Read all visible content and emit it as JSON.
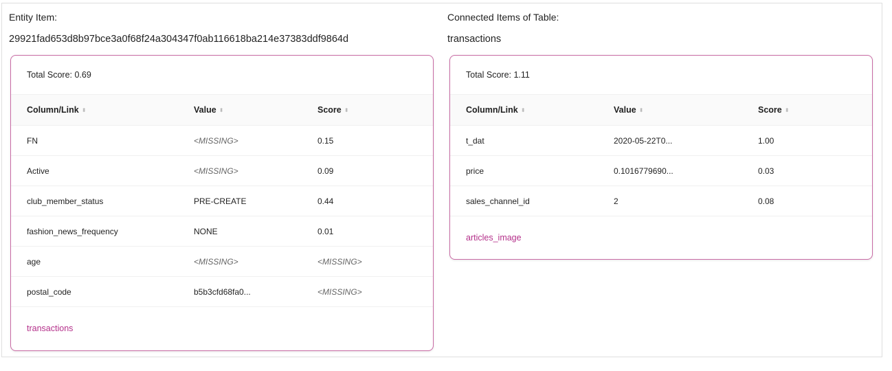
{
  "entity": {
    "title": "Entity Item:",
    "id": "29921fad653d8b97bce3a0f68f24a304347f0ab116618ba214e37383ddf9864d",
    "card": {
      "total_score": "Total Score: 0.69",
      "columns": [
        "Column/Link",
        "Value",
        "Score"
      ],
      "rows": [
        {
          "column": "FN",
          "value": "<MISSING>",
          "value_missing": true,
          "score": "0.15",
          "score_missing": false
        },
        {
          "column": "Active",
          "value": "<MISSING>",
          "value_missing": true,
          "score": "0.09",
          "score_missing": false
        },
        {
          "column": "club_member_status",
          "value": "PRE-CREATE",
          "value_missing": false,
          "score": "0.44",
          "score_missing": false
        },
        {
          "column": "fashion_news_frequency",
          "value": "NONE",
          "value_missing": false,
          "score": "0.01",
          "score_missing": false
        },
        {
          "column": "age",
          "value": "<MISSING>",
          "value_missing": true,
          "score": "<MISSING>",
          "score_missing": true
        },
        {
          "column": "postal_code",
          "value": "b5b3cfd68fa0...",
          "value_missing": false,
          "score": "<MISSING>",
          "score_missing": true
        }
      ],
      "link": "transactions"
    }
  },
  "connected": {
    "title": "Connected Items of Table:",
    "table_name": "transactions",
    "card": {
      "total_score": "Total Score: 1.11",
      "columns": [
        "Column/Link",
        "Value",
        "Score"
      ],
      "rows": [
        {
          "column": "t_dat",
          "value": "2020-05-22T0...",
          "value_missing": false,
          "score": "1.00",
          "score_missing": false
        },
        {
          "column": "price",
          "value": "0.1016779690...",
          "value_missing": false,
          "score": "0.03",
          "score_missing": false
        },
        {
          "column": "sales_channel_id",
          "value": "2",
          "value_missing": false,
          "score": "0.08",
          "score_missing": false
        }
      ],
      "link": "articles_image"
    }
  },
  "colors": {
    "accent": "#b4308a",
    "card_border": "#c86aa4"
  },
  "icons": {
    "sort": "sort-icon"
  }
}
